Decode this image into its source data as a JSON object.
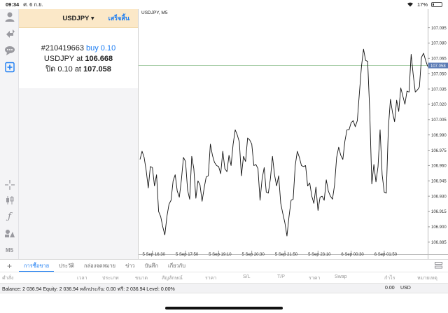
{
  "statusbar": {
    "time": "09:34",
    "date": "ศ. 6 ก.ย.",
    "battery": "17%",
    "battery_level": 0.17,
    "wifi_icon": "wifi-icon"
  },
  "toolbar": {
    "icons": [
      "account-icon",
      "trade-icon",
      "chat-icon",
      "new-order-icon",
      "crosshair-icon",
      "candles-icon",
      "function-icon",
      "objects-icon"
    ],
    "timeframe": "M5"
  },
  "order_panel": {
    "title": "USDJPY ▾",
    "done_label": "เสร็จสิ้น",
    "order_id": "#210419663",
    "order_type": "buy 0.10",
    "line2_prefix": "USDJPY at",
    "open_price": "106.668",
    "line3_prefix": "ปิด 0.10 at",
    "close_price": "107.058"
  },
  "chart": {
    "label": "USDJPY, M5",
    "current_price": "107.058",
    "colors": {
      "line": "#111111",
      "price_line": "#8fbf8f",
      "price_tag": "#5b7bb5"
    }
  },
  "chart_data": {
    "type": "line",
    "title": "USDJPY, M5",
    "xlabel": "",
    "ylabel": "",
    "ylim": [
      106.878,
      107.105
    ],
    "y_ticks": [
      "107.095",
      "107.080",
      "107.065",
      "107.050",
      "107.035",
      "107.020",
      "107.005",
      "106.990",
      "106.975",
      "106.960",
      "106.945",
      "106.930",
      "106.915",
      "106.900",
      "106.885"
    ],
    "x_ticks": [
      {
        "label": "5 Sep 16:30",
        "index": 6
      },
      {
        "label": "5 Sep 17:50",
        "index": 22
      },
      {
        "label": "5 Sep 19:10",
        "index": 38
      },
      {
        "label": "5 Sep 20:30",
        "index": 54
      },
      {
        "label": "5 Sep 21:50",
        "index": 70
      },
      {
        "label": "5 Sep 23:10",
        "index": 86
      },
      {
        "label": "6 Sep 00:30",
        "index": 102
      },
      {
        "label": "6 Sep 01:50",
        "index": 118
      }
    ],
    "price_line": 107.058,
    "series": [
      {
        "values": [
          106.966,
          106.974,
          106.968,
          106.955,
          106.938,
          106.959,
          106.958,
          106.94,
          106.951,
          106.915,
          106.91,
          106.9,
          106.892,
          106.91,
          106.922,
          106.926,
          106.945,
          106.951,
          106.935,
          106.929,
          106.946,
          106.968,
          106.964,
          106.936,
          106.927,
          106.969,
          106.957,
          106.928,
          106.945,
          106.941,
          106.925,
          106.938,
          106.949,
          106.95,
          106.981,
          106.97,
          106.963,
          106.96,
          106.959,
          106.952,
          106.974,
          106.957,
          106.954,
          106.97,
          106.96,
          106.981,
          106.995,
          106.99,
          106.983,
          106.95,
          106.969,
          106.964,
          106.987,
          106.985,
          106.981,
          106.96,
          106.961,
          106.957,
          106.926,
          106.947,
          106.958,
          106.934,
          106.933,
          106.947,
          106.969,
          106.951,
          106.94,
          106.95,
          106.923,
          106.913,
          106.904,
          106.891,
          106.91,
          106.926,
          106.927,
          106.96,
          106.974,
          106.968,
          106.96,
          106.959,
          106.96,
          106.94,
          106.943,
          106.93,
          106.923,
          106.939,
          106.916,
          106.929,
          106.93,
          106.926,
          106.946,
          106.935,
          106.93,
          106.927,
          106.941,
          106.968,
          106.978,
          106.97,
          106.966,
          106.984,
          106.995,
          106.995,
          107.002,
          107.004,
          106.998,
          107.004,
          107.031,
          107.057,
          107.074,
          107.063,
          107.062,
          107.013,
          106.942,
          106.961,
          106.944,
          106.959,
          106.995,
          106.951,
          106.934,
          106.933,
          106.997,
          107.025,
          107.012,
          107.003,
          107.024,
          107.013,
          107.036,
          107.028,
          107.02,
          107.033,
          107.032,
          107.069,
          107.049,
          107.032,
          107.034,
          107.037,
          107.066,
          107.07,
          107.063,
          107.057
        ]
      }
    ]
  },
  "bottom_tabs": {
    "items": [
      {
        "label": "การซื้อขาย",
        "active": true
      },
      {
        "label": "ประวัติ",
        "active": false
      },
      {
        "label": "กล่องจดหมาย",
        "active": false
      },
      {
        "label": "ข่าว",
        "active": false
      },
      {
        "label": "บันทึก",
        "active": false
      },
      {
        "label": "เกี่ยวกับ",
        "active": false
      }
    ]
  },
  "columns": [
    "คำสั่ง",
    "เวลา",
    "ประเภท",
    "ขนาด",
    "สัญลักษณ์",
    "ราคา",
    "S/L",
    "T/P",
    "ราคา",
    "Swap",
    "กำไร",
    "หมายเหตุ"
  ],
  "account": {
    "summary": "Balance: 2 036.94 Equity: 2 036.94 หลักประกัน: 0.00 ฟรี: 2 036.94 Level: 0.00%",
    "profit": "0.00",
    "currency": "USD"
  }
}
